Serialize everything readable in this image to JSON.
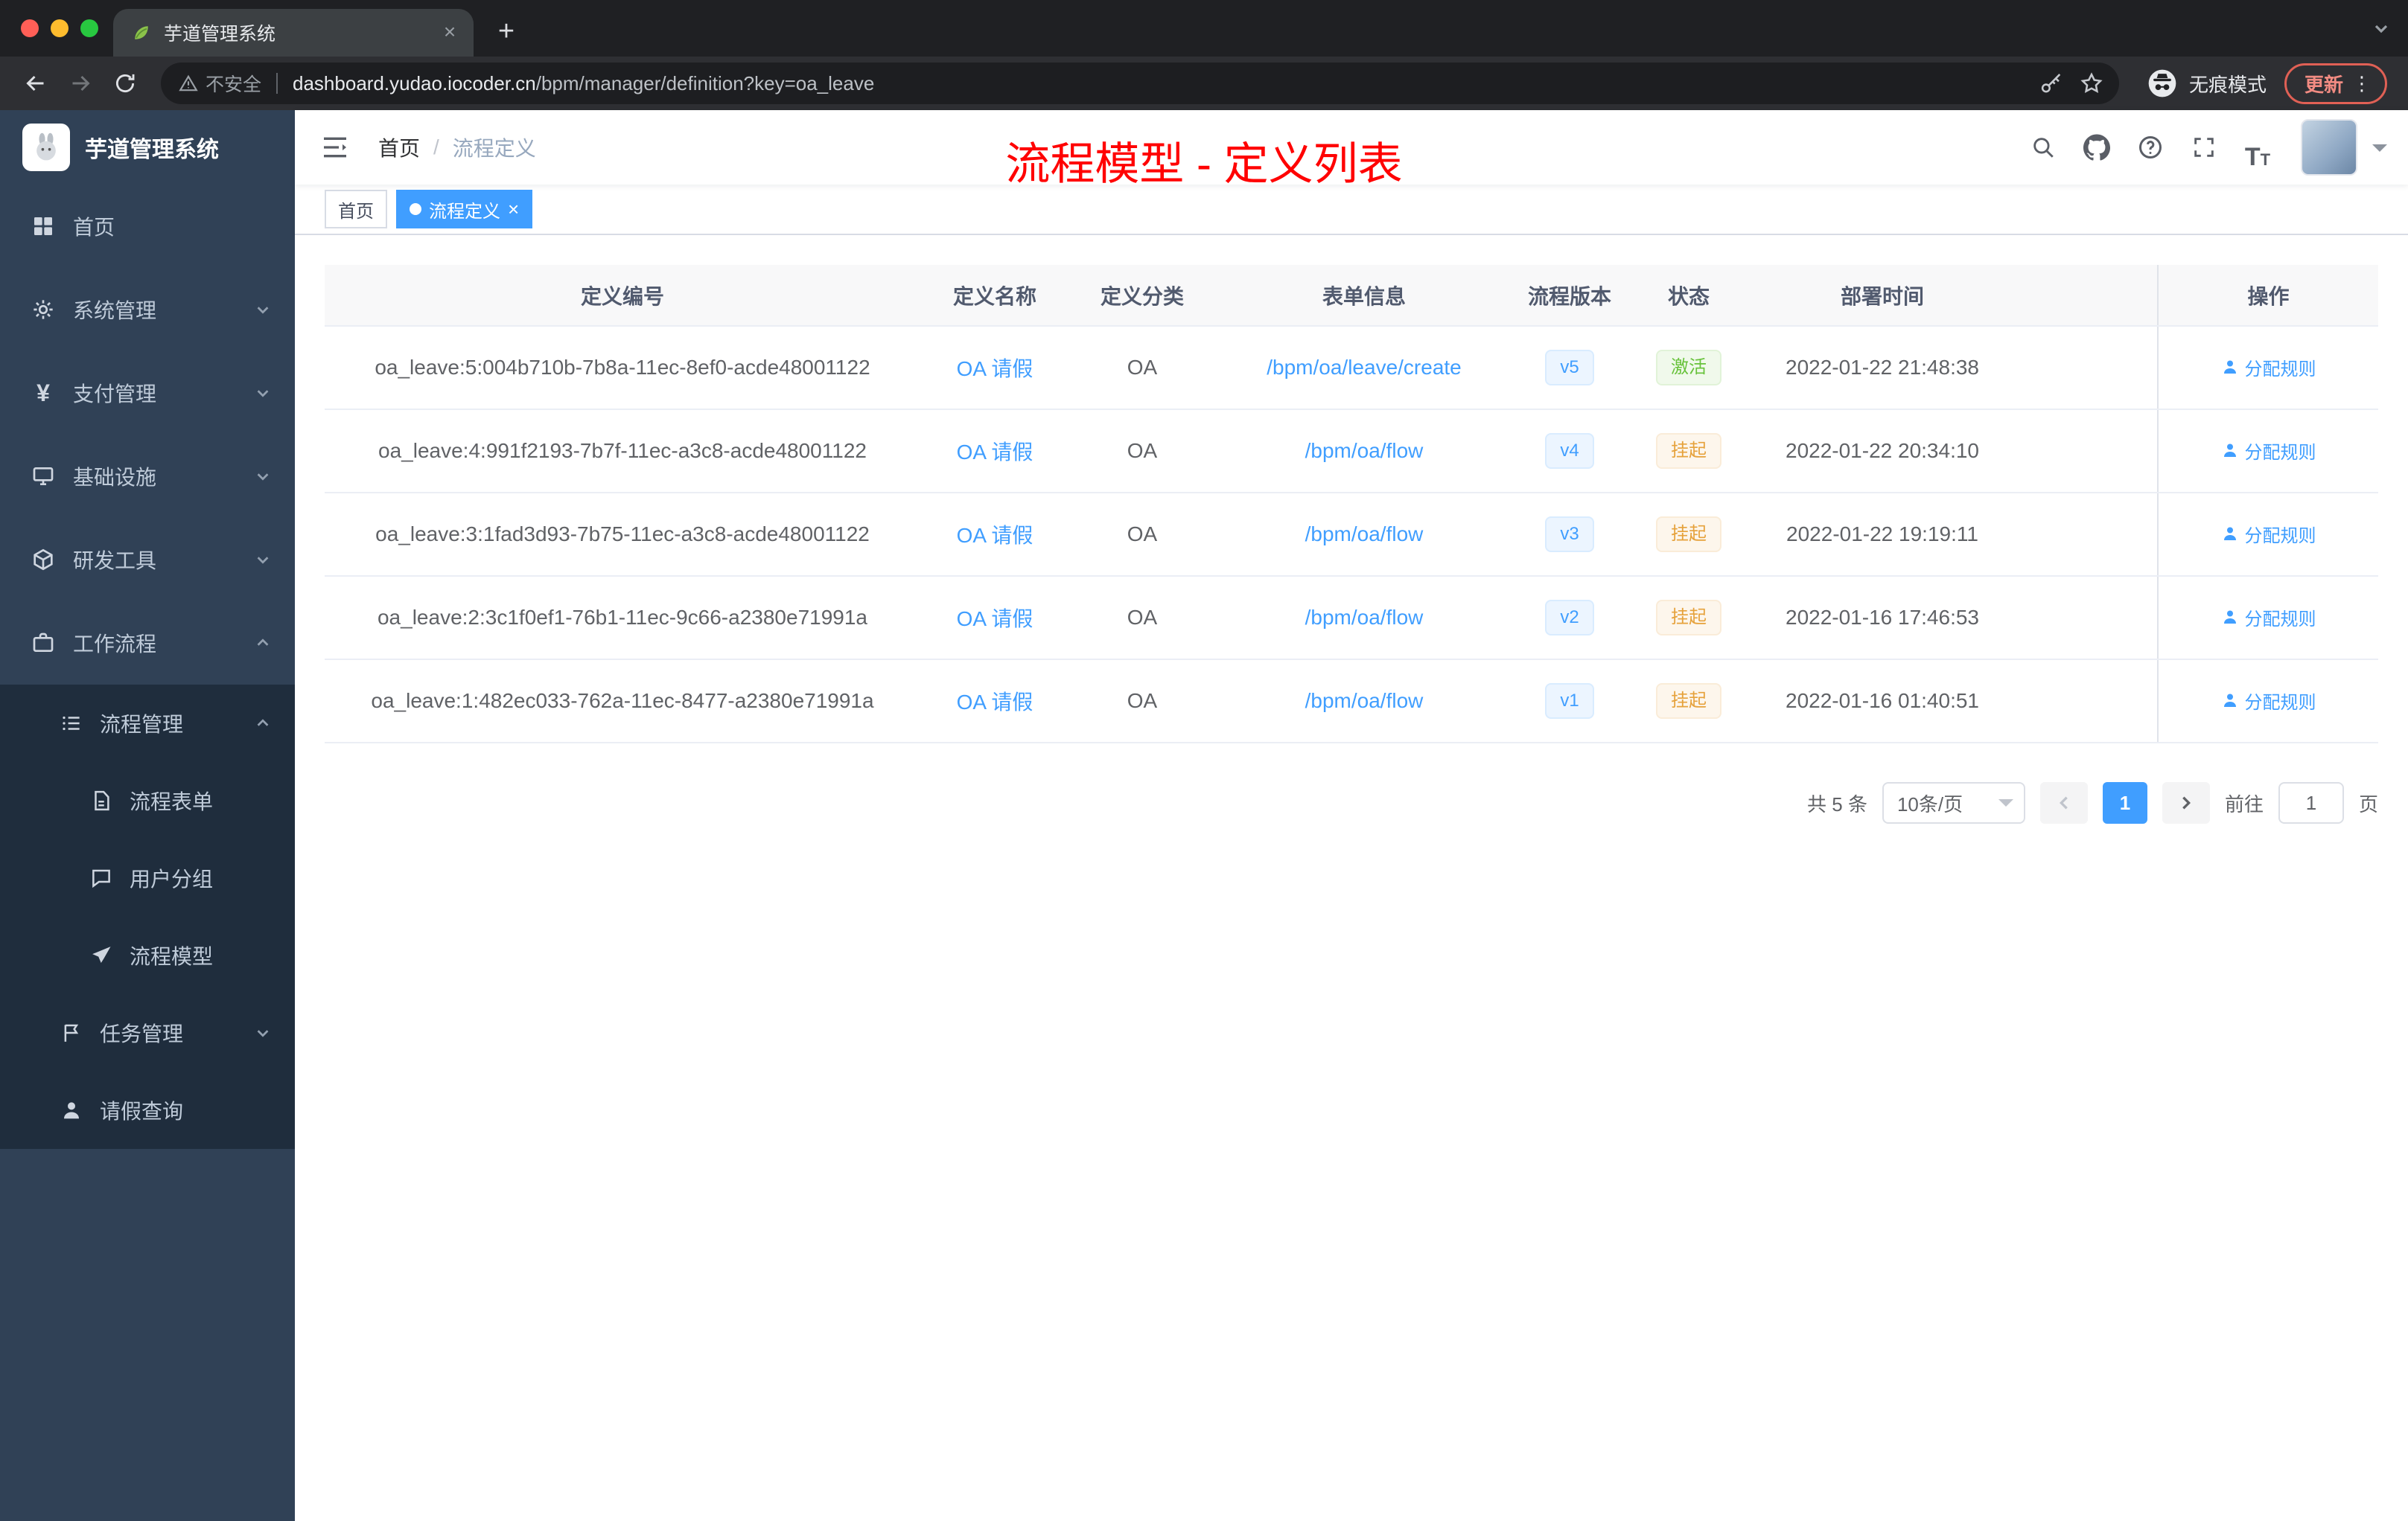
{
  "colors": {
    "accent": "#409eff",
    "status_active": "#67c23a",
    "status_suspended": "#e6a23c",
    "annotation_red": "#ff0000",
    "sidebar_bg": "#304156",
    "submenu_bg": "#1f2d3d"
  },
  "icon_names": [
    "leaf-favicon",
    "close-icon",
    "new-tab-icon",
    "chevron-down-icon",
    "back-icon",
    "forward-icon",
    "reload-icon",
    "warning-triangle-icon",
    "key-icon",
    "star-icon",
    "incognito-icon",
    "kebab-menu-icon",
    "dashboard-icon",
    "gear-icon",
    "yen-icon",
    "monitor-icon",
    "cube-icon",
    "briefcase-icon",
    "list-icon",
    "document-icon",
    "chat-bubble-icon",
    "paper-plane-icon",
    "flag-icon",
    "person-icon",
    "hamburger-icon",
    "search-icon",
    "github-icon",
    "question-icon",
    "fullscreen-icon",
    "font-size-icon",
    "user-icon"
  ],
  "browser": {
    "tab_title": "芋道管理系统",
    "security_label": "不安全",
    "url_domain": "dashboard.yudao.iocoder.cn",
    "url_path": "/bpm/manager/definition?key=oa_leave",
    "incognito_label": "无痕模式",
    "update_label": "更新"
  },
  "sidebar": {
    "app_title": "芋道管理系统",
    "menu": [
      {
        "label": "首页"
      },
      {
        "label": "系统管理"
      },
      {
        "label": "支付管理"
      },
      {
        "label": "基础设施"
      },
      {
        "label": "研发工具"
      },
      {
        "label": "工作流程"
      }
    ],
    "workflow": {
      "process_mgmt_label": "流程管理",
      "process_items": [
        {
          "label": "流程表单"
        },
        {
          "label": "用户分组"
        },
        {
          "label": "流程模型"
        }
      ],
      "task_mgmt_label": "任务管理",
      "leave_query_label": "请假查询"
    }
  },
  "header": {
    "breadcrumb_home": "首页",
    "breadcrumb_sep": "/",
    "breadcrumb_current": "流程定义",
    "annotation": "流程模型 - 定义列表"
  },
  "tags": {
    "home": "首页",
    "active": "流程定义"
  },
  "table": {
    "columns": [
      "定义编号",
      "定义名称",
      "定义分类",
      "表单信息",
      "流程版本",
      "状态",
      "部署时间",
      "操作"
    ],
    "rows": [
      {
        "id": "oa_leave:5:004b710b-7b8a-11ec-8ef0-acde48001122",
        "name": "OA 请假",
        "category": "OA",
        "form": "/bpm/oa/leave/create",
        "version": "v5",
        "status": "激活",
        "time": "2022-01-22 21:48:38",
        "action": "分配规则"
      },
      {
        "id": "oa_leave:4:991f2193-7b7f-11ec-a3c8-acde48001122",
        "name": "OA 请假",
        "category": "OA",
        "form": "/bpm/oa/flow",
        "version": "v4",
        "status": "挂起",
        "time": "2022-01-22 20:34:10",
        "action": "分配规则"
      },
      {
        "id": "oa_leave:3:1fad3d93-7b75-11ec-a3c8-acde48001122",
        "name": "OA 请假",
        "category": "OA",
        "form": "/bpm/oa/flow",
        "version": "v3",
        "status": "挂起",
        "time": "2022-01-22 19:19:11",
        "action": "分配规则"
      },
      {
        "id": "oa_leave:2:3c1f0ef1-76b1-11ec-9c66-a2380e71991a",
        "name": "OA 请假",
        "category": "OA",
        "form": "/bpm/oa/flow",
        "version": "v2",
        "status": "挂起",
        "time": "2022-01-16 17:46:53",
        "action": "分配规则"
      },
      {
        "id": "oa_leave:1:482ec033-762a-11ec-8477-a2380e71991a",
        "name": "OA 请假",
        "category": "OA",
        "form": "/bpm/oa/flow",
        "version": "v1",
        "status": "挂起",
        "time": "2022-01-16 01:40:51",
        "action": "分配规则"
      }
    ]
  },
  "pagination": {
    "total": "共 5 条",
    "page_size": "10条/页",
    "current_page": "1",
    "goto_label": "前往",
    "goto_value": "1",
    "page_unit": "页"
  }
}
